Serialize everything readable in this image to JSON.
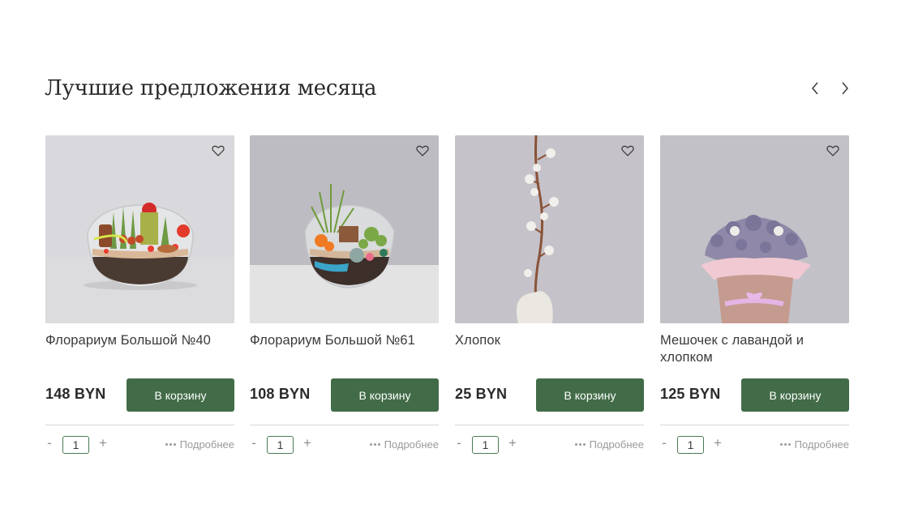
{
  "section": {
    "title": "Лучшие предложения месяца",
    "prev_icon": "chevron-left-icon",
    "next_icon": "chevron-right-icon"
  },
  "colors": {
    "accent": "#426c48",
    "qty_border": "#4c7a52",
    "muted": "#9a9a9a"
  },
  "products": [
    {
      "name": "Флорариум Большой №40",
      "price": "148 BYN",
      "cart_label": "В корзину",
      "qty": "1",
      "minus": "-",
      "plus": "+",
      "more_label": "Подробнее"
    },
    {
      "name": "Флорариум Большой №61",
      "price": "108 BYN",
      "cart_label": "В корзину",
      "qty": "1",
      "minus": "-",
      "plus": "+",
      "more_label": "Подробнее"
    },
    {
      "name": "Хлопок",
      "price": "25 BYN",
      "cart_label": "В корзину",
      "qty": "1",
      "minus": "-",
      "plus": "+",
      "more_label": "Подробнее"
    },
    {
      "name": "Мешочек с лавандой и хлопком",
      "price": "125 BYN",
      "cart_label": "В корзину",
      "qty": "1",
      "minus": "-",
      "plus": "+",
      "more_label": "Подробнее"
    }
  ]
}
